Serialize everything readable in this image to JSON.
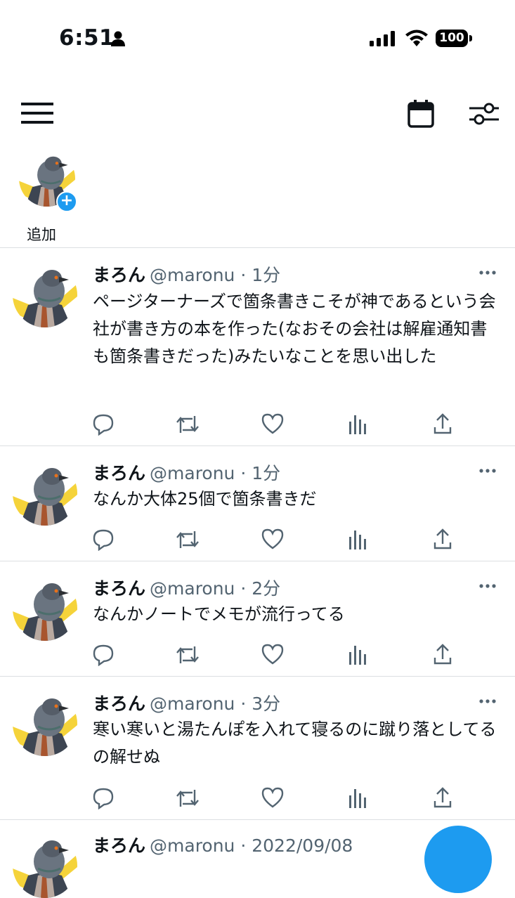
{
  "status_bar": {
    "time": "6:51",
    "battery": "100"
  },
  "fleet": {
    "label": "追加"
  },
  "tweets": [
    {
      "name": "まろん",
      "handle": "@maronu · 1分",
      "text": "ページターナーズで箇条書きこそが神であるという会社が書き方の本を作った(なおその会社は解雇通知書も箇条書きだった)みたいなことを思い出した"
    },
    {
      "name": "まろん",
      "handle": "@maronu · 1分",
      "text": "なんか大体25個で箇条書きだ"
    },
    {
      "name": "まろん",
      "handle": "@maronu · 2分",
      "text": "なんかノートでメモが流行ってる"
    },
    {
      "name": "まろん",
      "handle": "@maronu · 3分",
      "text": "寒い寒いと湯たんぽを入れて寝るのに蹴り落としてるの解せぬ"
    },
    {
      "name": "まろん",
      "handle": "@maronu · 2022/09/08",
      "text": ""
    }
  ],
  "colors": {
    "accent": "#1d9bf0",
    "secondary_text": "#536471",
    "divider": "#dcdfe2"
  }
}
